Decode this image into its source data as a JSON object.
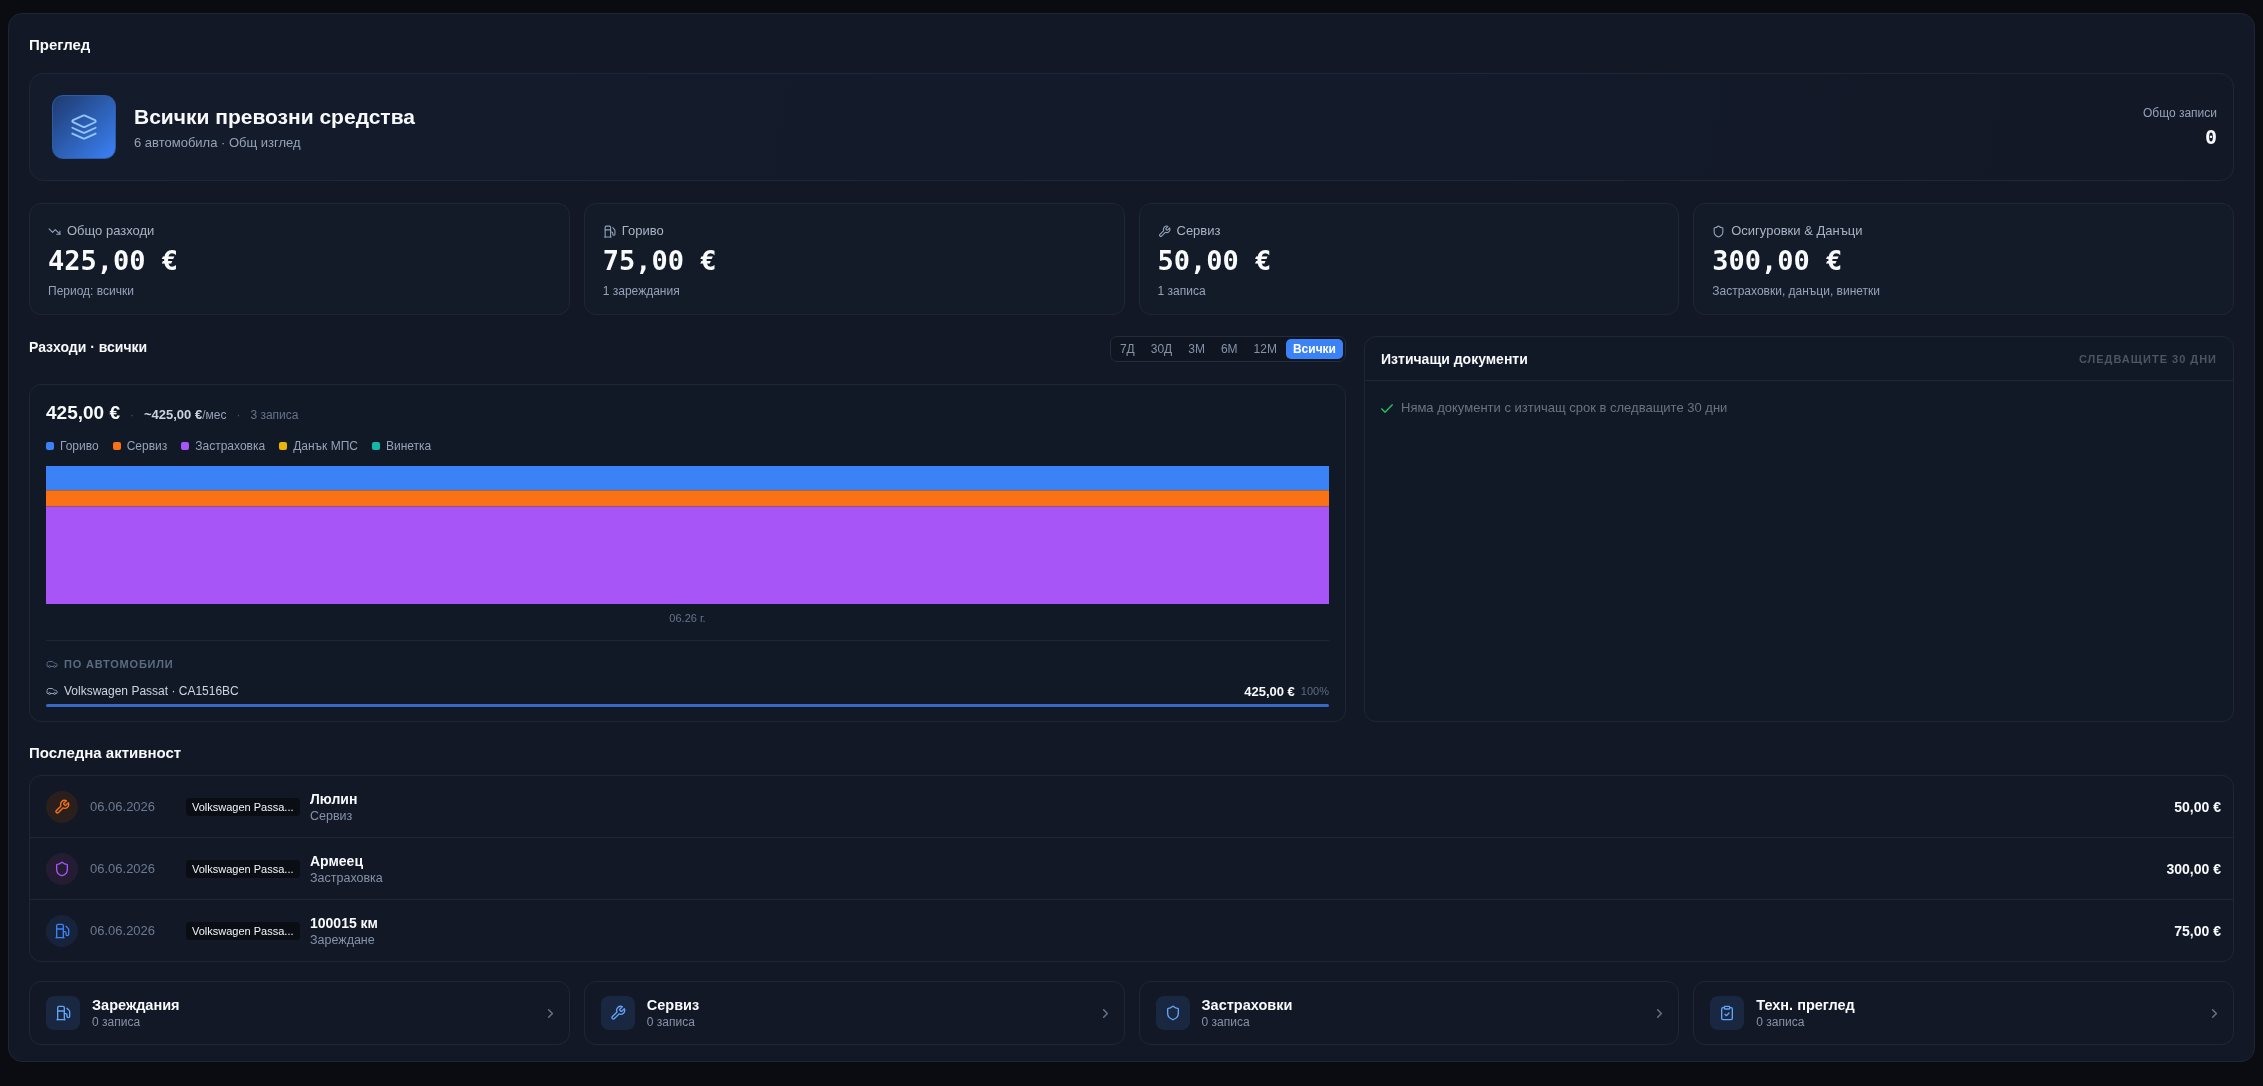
{
  "page": {
    "title": "Преглед"
  },
  "hero": {
    "title": "Всички превозни средства",
    "subtitle": "6 автомобила · Общ изглед",
    "records_label": "Общо записи",
    "records_value": "0"
  },
  "stats": [
    {
      "kind": "expenses",
      "label": "Общо разходи",
      "value": "425,00 €",
      "note": "Период: всички"
    },
    {
      "kind": "fuel",
      "label": "Гориво",
      "value": "75,00 €",
      "note": "1 зареждания"
    },
    {
      "kind": "service",
      "label": "Сервиз",
      "value": "50,00 €",
      "note": "1 записа"
    },
    {
      "kind": "insurance",
      "label": "Осигуровки & Данъци",
      "value": "300,00 €",
      "note": "Застраховки, данъци, винетки"
    }
  ],
  "expenses": {
    "title": "Разходи · всички",
    "periods": [
      {
        "label": "7Д",
        "selected": false
      },
      {
        "label": "30Д",
        "selected": false
      },
      {
        "label": "3М",
        "selected": false
      },
      {
        "label": "6М",
        "selected": false
      },
      {
        "label": "12М",
        "selected": false
      },
      {
        "label": "Всички",
        "selected": true
      }
    ],
    "summary": [
      {
        "kind": "total",
        "text": "425,00 €"
      },
      {
        "kind": "separator",
        "text": "·"
      },
      {
        "kind": "monthly",
        "text": "~425,00 €",
        "unit": "/мес"
      },
      {
        "kind": "separator",
        "text": "·"
      },
      {
        "kind": "count",
        "text": "3 записа"
      }
    ],
    "legend": [
      {
        "label": "Гориво",
        "color": "#3b82f6"
      },
      {
        "label": "Сервиз",
        "color": "#f97316"
      },
      {
        "label": "Застраховка",
        "color": "#a855f7"
      },
      {
        "label": "Данък МПС",
        "color": "#eab308"
      },
      {
        "label": "Винетка",
        "color": "#14b8a6"
      }
    ],
    "x_label": "06.26 г.",
    "by_vehicle": {
      "title": "ПО АВТОМОБИЛИ",
      "items": [
        {
          "name": "Volkswagen Passat · CA1516BC",
          "amount": "425,00 €",
          "share": "100%",
          "level": 1
        }
      ]
    }
  },
  "expiring": {
    "title": "Изтичащи документи",
    "range": "СЛЕДВАЩИТЕ 30 ДНИ",
    "empty_message": "Няма документи с изтичащ срок в следващите 30 дни"
  },
  "activity": {
    "title": "Последна активност",
    "rows": [
      {
        "kind": "service",
        "date": "06.06.2026",
        "vehicle": "Volkswagen Passa...",
        "title": "Люлин",
        "subtitle": "Сервиз",
        "amount": "50,00 €"
      },
      {
        "kind": "insurance",
        "date": "06.06.2026",
        "vehicle": "Volkswagen Passa...",
        "title": "Армеец",
        "subtitle": "Застраховка",
        "amount": "300,00 €"
      },
      {
        "kind": "fuel",
        "date": "06.06.2026",
        "vehicle": "Volkswagen Passa...",
        "title": "100015 км",
        "subtitle": "Зареждане",
        "amount": "75,00 €"
      }
    ]
  },
  "shortcuts": [
    {
      "kind": "fuel",
      "title": "Зареждания",
      "count": "0 записа"
    },
    {
      "kind": "service",
      "title": "Сервиз",
      "count": "0 записа"
    },
    {
      "kind": "insurance",
      "title": "Застраховки",
      "count": "0 записа"
    },
    {
      "kind": "inspection",
      "title": "Техн. преглед",
      "count": "0 записа"
    }
  ]
}
